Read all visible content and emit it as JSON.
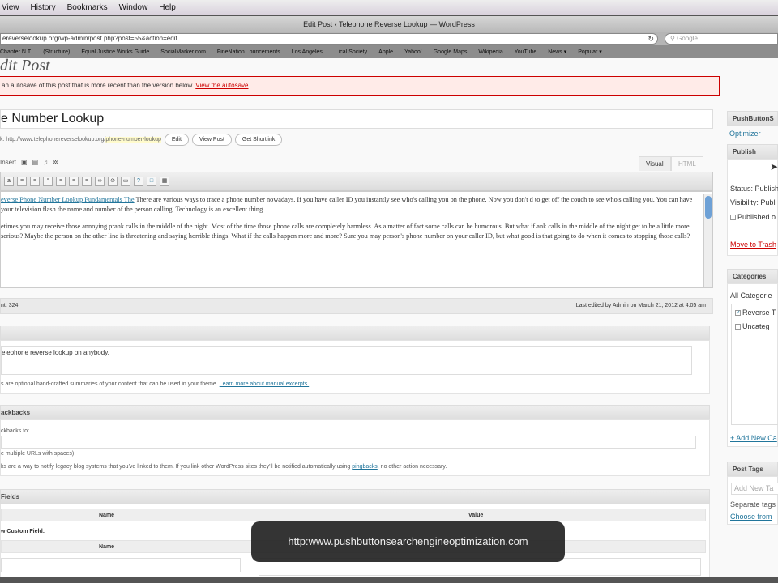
{
  "menubar": {
    "items": [
      "View",
      "History",
      "Bookmarks",
      "Window",
      "Help"
    ]
  },
  "browser": {
    "title": "Edit Post ‹ Telephone Reverse Lookup — WordPress",
    "url": "ereverselookup.org/wp-admin/post.php?post=55&action=edit",
    "search_placeholder": "Google",
    "bookmarks": [
      "Chapter N.T.",
      "(Structure)",
      "Equal Justice Works Guide",
      "SocialMarker.com",
      "FineNation...ouncements",
      "Los Angeles",
      "...ical Society",
      "Apple",
      "Yahoo!",
      "Google Maps",
      "Wikipedia",
      "YouTube",
      "News ▾",
      "Popular ▾"
    ]
  },
  "page": {
    "heading": "dit Post",
    "notice": "an autosave of this post that is more recent than the version below.",
    "notice_link": "View the autosave",
    "post_title": "e Number Lookup",
    "permalink_prefix": "k: http://www.telephonereverselookup.org/",
    "permalink_slug": "phone-number-lookup",
    "permalink_buttons": [
      "Edit",
      "View Post",
      "Get Shortlink"
    ],
    "upload_label": "Insert",
    "tabs": [
      "Visual",
      "HTML"
    ],
    "editor": {
      "link_text": "everse Phone Number Lookup Fundamentals The",
      "p1": " There are various ways to trace a phone number nowadays. If you have caller ID you instantly see who's calling you on the phone. Now you don't d to get off the couch to see who's calling you. You can have your television flash the name and number of the person calling. Technology is an excellent thing.",
      "p2": "etimes you may receive those annoying prank calls in the middle of the night. Most of the time those phone calls are completely harmless. As a matter of fact some calls can be humorous. But what if ank calls in the middle of the night get to be a little more serious? Maybe the person on the other line is threatening and saying horrible things. What if the calls happen more and more? Sure you may person's phone number on your caller ID, but what good is that going to do when it comes to stopping those calls?"
    },
    "word_count": "nt: 324",
    "last_edited": "Last edited by Admin on March 21, 2012 at 4:05 am",
    "excerpt": {
      "value": "elephone reverse lookup on anybody.",
      "help": "s are optional hand-crafted summaries of your content that can be used in your theme.",
      "help_link": "Learn more about manual excerpts."
    },
    "trackbacks": {
      "title": "ackbacks",
      "label": "ckbacks to:",
      "hint": "e multiple URLs with spaces)",
      "help": "ks are a way to notify legacy blog systems that you've linked to them. If you link other WordPress sites they'll be notified automatically using",
      "help_link": "pingbacks",
      "help_end": ", no other action necessary."
    },
    "custom_fields": {
      "title": "Fields",
      "col_name": "Name",
      "col_value": "Value",
      "add_new": "w Custom Field:",
      "col_name2": "Name"
    }
  },
  "sidebar": {
    "plugin_title": "PushButtonS",
    "plugin_link": "Optimizer",
    "publish_title": "Publish",
    "status": "Status: Publish",
    "visibility": "Visibility: Publi",
    "published_on": "Published o",
    "trash": "Move to Trash",
    "categories_title": "Categories",
    "all_categories": "All Categorie",
    "cat_items": [
      {
        "label": "Reverse T",
        "checked": true
      },
      {
        "label": "Uncateg",
        "checked": false
      }
    ],
    "add_category": "+ Add New Ca",
    "tags_title": "Post Tags",
    "tags_placeholder": "Add New Ta",
    "tags_hint": "Separate tags",
    "tags_choose": "Choose from"
  },
  "overlay": {
    "text": "http:www.pushbuttonsearchengineoptimization.com"
  }
}
